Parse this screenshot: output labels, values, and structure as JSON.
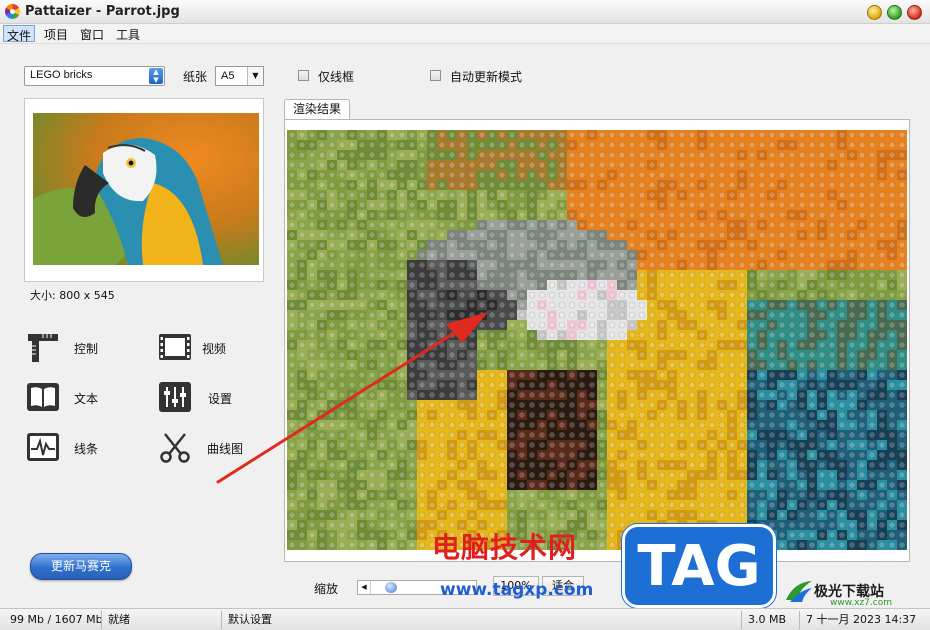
{
  "window": {
    "title": "Pattaizer - Parrot.jpg"
  },
  "menu": [
    "文件",
    "项目",
    "窗口",
    "工具"
  ],
  "toolbar": {
    "style_value": "LEGO bricks",
    "paper_label": "纸张",
    "paper_value": "A5",
    "wireframe_label": "仅线框",
    "auto_update_label": "自动更新模式"
  },
  "preview": {
    "size_label": "大小: 800 x 545"
  },
  "tools": [
    {
      "label": "控制",
      "icon": "ruler-square-icon"
    },
    {
      "label": "视频",
      "icon": "film-strip-icon"
    },
    {
      "label": "文本",
      "icon": "book-icon"
    },
    {
      "label": "设置",
      "icon": "sliders-icon"
    },
    {
      "label": "线条",
      "icon": "waveform-icon"
    },
    {
      "label": "曲线图",
      "icon": "scissors-icon"
    }
  ],
  "update_button": "更新马赛克",
  "render": {
    "tab_label": "渲染结果"
  },
  "zoom": {
    "label": "缩放",
    "btn1": "100%",
    "btn2": "适合"
  },
  "status": {
    "memory": "99 Mb / 1607 Mb",
    "state": "就绪",
    "preset": "默认设置",
    "size": "3.0 MB",
    "datetime": "7 十一月 2023   14:37"
  },
  "watermark": {
    "text": "电脑技术网",
    "url": "www.tagxp.com",
    "badge": "TAG",
    "site_name": "极光下载站",
    "site_url": "www.xz7.com"
  },
  "colors": {
    "accent_blue": "#2f6fcc",
    "brick_orange": "#e8821e",
    "brick_yellow": "#e6b81a",
    "brick_green": "#8aa54a"
  }
}
